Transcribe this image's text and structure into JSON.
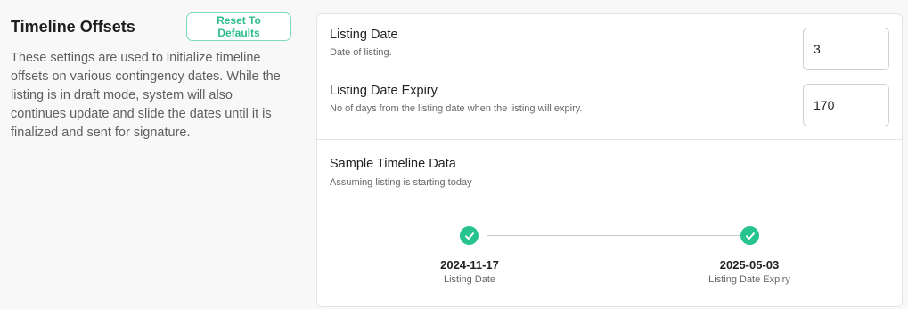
{
  "section": {
    "title": "Timeline Offsets",
    "reset_label": "Reset To Defaults",
    "description": "These settings are used to initialize timeline offsets on various contingency dates. While the listing is in draft mode, system will also continues update and slide the dates until it is finalized and sent for signature."
  },
  "fields": [
    {
      "label": "Listing Date",
      "help": "Date of listing.",
      "value": "3"
    },
    {
      "label": "Listing Date Expiry",
      "help": "No of days from the listing date when the listing will expiry.",
      "value": "170"
    }
  ],
  "sample": {
    "title": "Sample Timeline Data",
    "subtitle": "Assuming listing is starting today",
    "points": [
      {
        "date": "2024-11-17",
        "label": "Listing Date"
      },
      {
        "date": "2025-05-03",
        "label": "Listing Date Expiry"
      }
    ]
  },
  "colors": {
    "accent": "#27c48f"
  }
}
